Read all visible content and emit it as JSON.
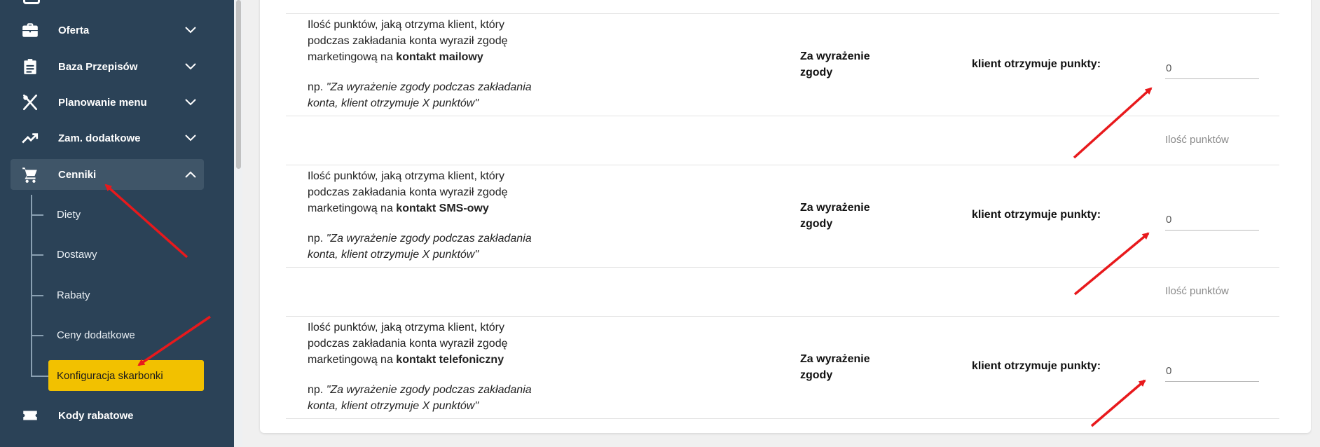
{
  "sidebar": {
    "items": [
      {
        "label": "Oferta",
        "icon": "briefcase-icon"
      },
      {
        "label": "Baza Przepisów",
        "icon": "clipboard-icon"
      },
      {
        "label": "Planowanie menu",
        "icon": "fork-knife-icon"
      },
      {
        "label": "Zam. dodatkowe",
        "icon": "trending-up-icon"
      },
      {
        "label": "Cenniki",
        "icon": "cart-icon"
      },
      {
        "label": "Kody rabatowe",
        "icon": "ticket-icon"
      }
    ],
    "sub_items": [
      "Diety",
      "Dostawy",
      "Rabaty",
      "Ceny dodatkowe"
    ],
    "active_sub_item": "Konfiguracja skarbonki"
  },
  "rows": [
    {
      "desc_line1": "Ilość punktów, jaką otrzyma klient, który",
      "desc_line2": "podczas zakładania konta wyraził zgodę",
      "desc_prefix": "marketingową na ",
      "desc_bold": "kontakt mailowy",
      "example_prefix": "np. ",
      "example_line1": "\"Za wyrażenie zgody podczas zakładania",
      "example_line2": "konta, klient otrzymuje X punktów\"",
      "zgody_line1": "Za wyrażenie",
      "zgody_line2": "zgody",
      "klient_label": "klient otrzymuje punkty:",
      "value": "0",
      "hint": "Ilość punktów"
    },
    {
      "desc_line1": "Ilość punktów, jaką otrzyma klient, który",
      "desc_line2": "podczas zakładania konta wyraził zgodę",
      "desc_prefix": "marketingową na ",
      "desc_bold": "kontakt SMS-owy",
      "example_prefix": "np. ",
      "example_line1": "\"Za wyrażenie zgody podczas zakładania",
      "example_line2": "konta, klient otrzymuje X punktów\"",
      "zgody_line1": "Za wyrażenie",
      "zgody_line2": "zgody",
      "klient_label": "klient otrzymuje punkty:",
      "value": "0",
      "hint": "Ilość punktów"
    },
    {
      "desc_line1": "Ilość punktów, jaką otrzyma klient, który",
      "desc_line2": "podczas zakładania konta wyraził zgodę",
      "desc_prefix": "marketingową na ",
      "desc_bold": "kontakt telefoniczny",
      "example_prefix": "np. ",
      "example_line1": "\"Za wyrażenie zgody podczas zakładania",
      "example_line2": "konta, klient otrzymuje X punktów\"",
      "zgody_line1": "Za wyrażenie",
      "zgody_line2": "zgody",
      "klient_label": "klient otrzymuje punkty:",
      "value": "0"
    }
  ],
  "colors": {
    "sidebar_bg": "#2b4257",
    "active_item_bg": "#3f5568",
    "active_sub_bg": "#f2c100",
    "annotation_arrow": "#e8191c"
  }
}
